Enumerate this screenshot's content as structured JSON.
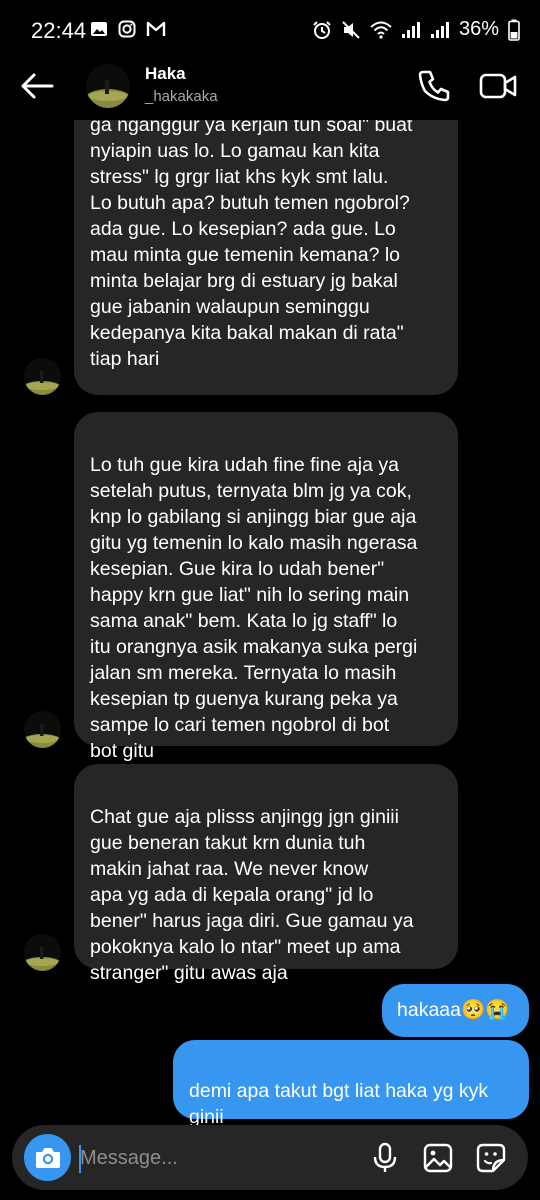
{
  "status_bar": {
    "time": "22:44",
    "battery_percent": "36%"
  },
  "header": {
    "name": "Haka",
    "username": "_hakakaka"
  },
  "messages": [
    {
      "from": "them",
      "text": "...anjing ya lo kalo butuh apa apa...\nga nganggur ya kerjain tuh soal\" buat\nnyiapin uas lo. Lo gamau kan kita\nstress\" lg grgr liat khs kyk smt lalu.\nLo butuh apa? butuh temen ngobrol?\nada gue. Lo kesepian? ada gue. Lo\nmau minta gue temenin kemana? lo\nminta belajar brg di estuary jg bakal\ngue jabanin walaupun seminggu\nkedepanya kita bakal makan di rata\"\ntiap hari"
    },
    {
      "from": "them",
      "text": "Lo tuh gue kira udah fine fine aja ya\nsetelah putus, ternyata blm jg ya cok,\nknp lo gabilang si anjingg biar gue aja\ngitu yg temenin lo kalo masih ngerasa\nkesepian. Gue kira lo udah bener\"\nhappy krn gue liat\" nih lo sering main\nsama anak\" bem. Kata lo jg staff\" lo\nitu orangnya asik makanya suka pergi\njalan sm mereka. Ternyata lo masih\nkesepian tp guenya kurang peka ya\nsampe lo cari temen ngobrol di bot\nbot gitu"
    },
    {
      "from": "them",
      "text": "Chat gue aja plisss anjingg jgn giniii\ngue beneran takut krn dunia tuh\nmakin jahat raa. We never know\napa yg ada di kepala orang\" jd lo\nbener\" harus jaga diri. Gue gamau ya\npokoknya kalo lo ntar\" meet up ama\nstranger\" gitu awas aja"
    },
    {
      "from": "me",
      "text": "hakaaa🥺😭"
    },
    {
      "from": "me",
      "text": "demi apa takut bgt liat haka yg kyk\nginii"
    }
  ],
  "composer": {
    "placeholder": "Message..."
  },
  "icons": {
    "back": "arrow-left-icon",
    "call": "phone-icon",
    "video": "video-camera-icon",
    "camera": "camera-icon",
    "mic": "microphone-icon",
    "gallery": "gallery-icon",
    "sticker": "sticker-icon"
  },
  "colors": {
    "accent": "#3797f0",
    "incoming_bubble": "#262626",
    "background": "#000000"
  }
}
